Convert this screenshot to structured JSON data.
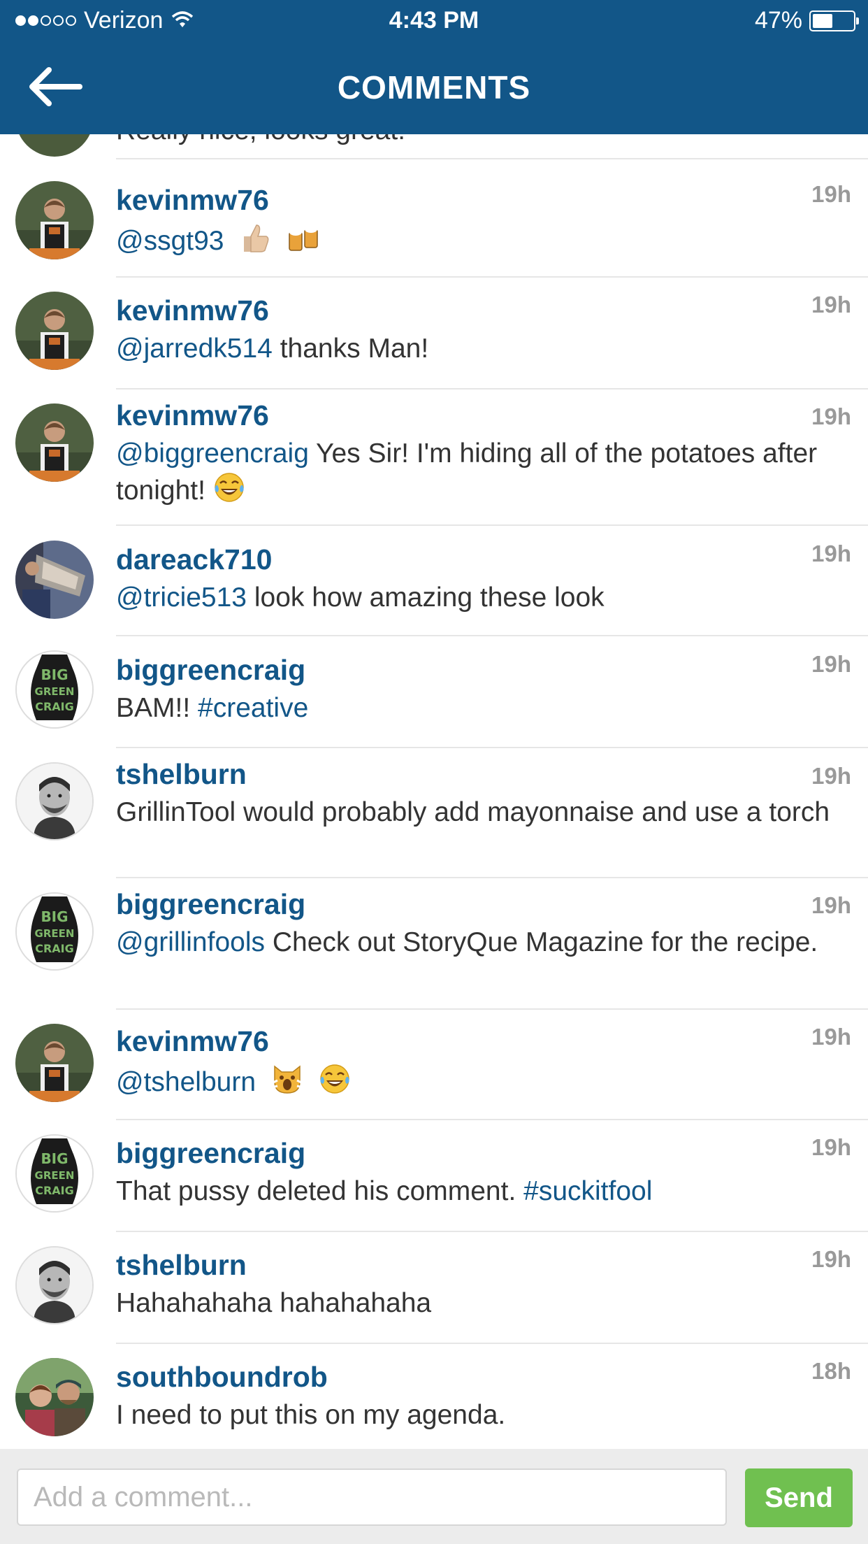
{
  "status": {
    "carrier": "Verizon",
    "time": "4:43 PM",
    "battery": "47%"
  },
  "nav": {
    "title": "COMMENTS"
  },
  "partial_comment": "Really nice, looks great!",
  "comments": [
    {
      "username": "kevinmw76",
      "time": "19h",
      "mention": "@ssgt93",
      "text": "",
      "emoji": "thumbs-up-beer"
    },
    {
      "username": "kevinmw76",
      "time": "19h",
      "mention": "@jarredk514",
      "text": " thanks Man!"
    },
    {
      "username": "kevinmw76",
      "time": "19h",
      "mention": "@biggreencraig",
      "text": " Yes Sir!  I'm hiding all of the potatoes after tonight!",
      "emoji": "laugh"
    },
    {
      "username": "dareack710",
      "time": "19h",
      "mention": "@tricie513",
      "text": " look how amazing these look"
    },
    {
      "username": "biggreencraig",
      "time": "19h",
      "text": "BAM!! ",
      "hashtag": "#creative"
    },
    {
      "username": "tshelburn",
      "time": "19h",
      "text": "GrillinTool would probably add mayonnaise and use a torch"
    },
    {
      "username": "biggreencraig",
      "time": "19h",
      "mention": "@grillinfools",
      "text": " Check out StoryQue Magazine for the recipe."
    },
    {
      "username": "kevinmw76",
      "time": "19h",
      "mention": "@tshelburn",
      "text": "",
      "emoji": "scream-laugh"
    },
    {
      "username": "biggreencraig",
      "time": "19h",
      "text": "That pussy deleted his comment. ",
      "hashtag": "#suckitfool"
    },
    {
      "username": "tshelburn",
      "time": "19h",
      "text": "Hahahahaha hahahahaha"
    },
    {
      "username": "southboundrob",
      "time": "18h",
      "text": "I need to put this on my agenda."
    }
  ],
  "input": {
    "placeholder": "Add a comment...",
    "send_label": "Send"
  },
  "colors": {
    "brand": "#125688",
    "send": "#70c050",
    "timestamp": "#999999"
  }
}
